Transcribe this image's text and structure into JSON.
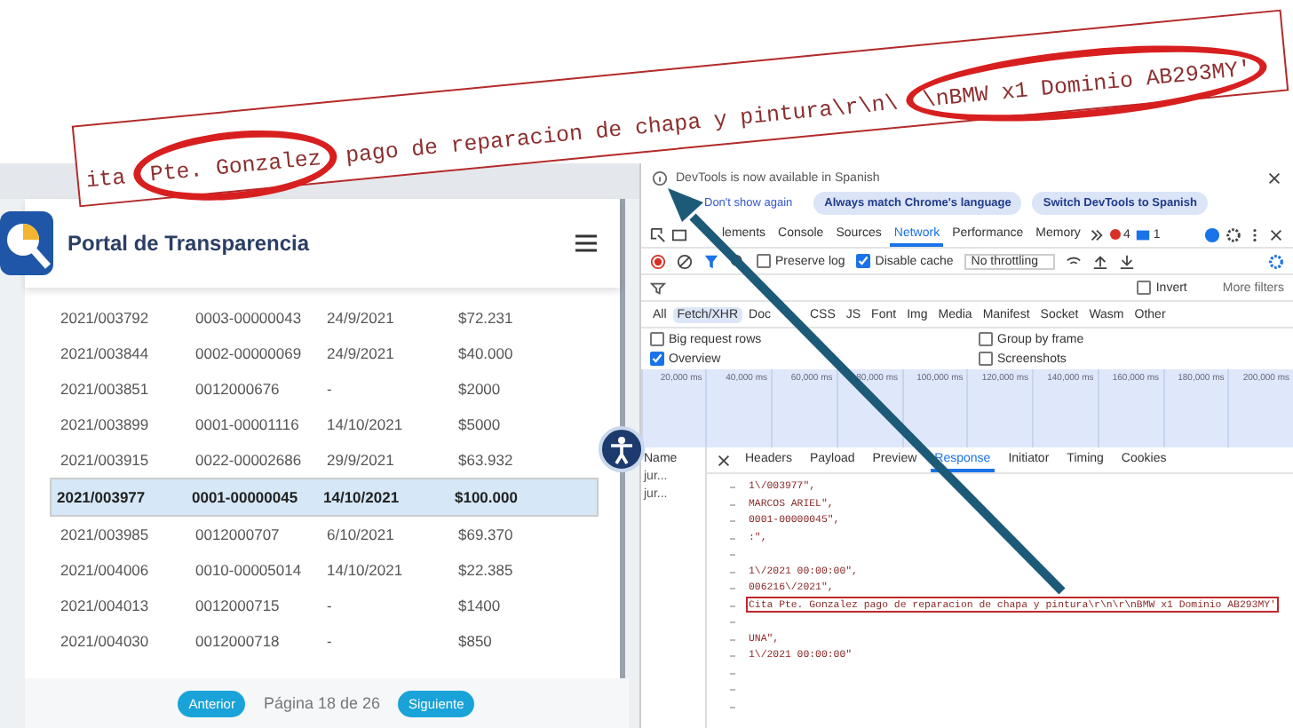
{
  "callout": {
    "segments": [
      {
        "text": "ita",
        "circled": false
      },
      {
        "text": "Pte. Gonzalez",
        "circled": true
      },
      {
        "text": "pago de reparacion de chapa y pintura\\r\\n\\",
        "circled": false
      },
      {
        "text": "\\nBMW x1 Dominio AB293MY'",
        "circled": true
      }
    ]
  },
  "site": {
    "title": "Portal de Transparencia",
    "rows": [
      {
        "cells": [
          "2021/003792",
          "0003-00000043",
          "24/9/2021",
          "$72.231"
        ],
        "selected": false
      },
      {
        "cells": [
          "2021/003844",
          "0002-00000069",
          "24/9/2021",
          "$40.000"
        ],
        "selected": false
      },
      {
        "cells": [
          "2021/003851",
          "0012000676",
          "-",
          "$2000"
        ],
        "selected": false
      },
      {
        "cells": [
          "2021/003899",
          "0001-00001116",
          "14/10/2021",
          "$5000"
        ],
        "selected": false
      },
      {
        "cells": [
          "2021/003915",
          "0022-00002686",
          "29/9/2021",
          "$63.932"
        ],
        "selected": false
      },
      {
        "cells": [
          "2021/003977",
          "0001-00000045",
          "14/10/2021",
          "$100.000"
        ],
        "selected": true
      },
      {
        "cells": [
          "2021/003985",
          "0012000707",
          "6/10/2021",
          "$69.370"
        ],
        "selected": false
      },
      {
        "cells": [
          "2021/004006",
          "0010-00005014",
          "14/10/2021",
          "$22.385"
        ],
        "selected": false
      },
      {
        "cells": [
          "2021/004013",
          "0012000715",
          "-",
          "$1400"
        ],
        "selected": false
      },
      {
        "cells": [
          "2021/004030",
          "0012000718",
          "-",
          "$850"
        ],
        "selected": false
      }
    ],
    "pagination": {
      "previous": "Anterior",
      "label": "Página 18 de 26",
      "next": "Siguiente"
    }
  },
  "devtools": {
    "banner": {
      "message": "DevTools is now available in Spanish",
      "buttons": [
        "Don't show again",
        "Always match Chrome's language",
        "Switch DevTools to Spanish"
      ]
    },
    "tabs": [
      {
        "label": "lements",
        "selected": false
      },
      {
        "label": "Console",
        "selected": false
      },
      {
        "label": "Sources",
        "selected": false
      },
      {
        "label": "Network",
        "selected": true
      },
      {
        "label": "Performance",
        "selected": false
      },
      {
        "label": "Memory",
        "selected": false
      }
    ],
    "errors": "4",
    "messages": "1",
    "preserve_log": {
      "label": "Preserve log",
      "checked": false
    },
    "disable_cache": {
      "label": "Disable cache",
      "checked": true
    },
    "throttling": "No throttling",
    "invert": {
      "label": "Invert",
      "checked": false
    },
    "more_filters": "More filters",
    "types": [
      {
        "label": "All",
        "selected": false
      },
      {
        "label": "Fetch/XHR",
        "selected": true
      },
      {
        "label": "Doc",
        "selected": false
      },
      {
        "label": "CSS",
        "selected": false
      },
      {
        "label": "JS",
        "selected": false
      },
      {
        "label": "Font",
        "selected": false
      },
      {
        "label": "Img",
        "selected": false
      },
      {
        "label": "Media",
        "selected": false
      },
      {
        "label": "Manifest",
        "selected": false
      },
      {
        "label": "Socket",
        "selected": false
      },
      {
        "label": "Wasm",
        "selected": false
      },
      {
        "label": "Other",
        "selected": false
      }
    ],
    "options": [
      {
        "label": "Big request rows",
        "checked": false
      },
      {
        "label": "Group by frame",
        "checked": false
      },
      {
        "label": "Overview",
        "checked": true
      },
      {
        "label": "Screenshots",
        "checked": false
      }
    ],
    "timeline_ticks": [
      "20,000 ms",
      "40,000 ms",
      "60,000 ms",
      "80,000 ms",
      "100,000 ms",
      "120,000 ms",
      "140,000 ms",
      "160,000 ms",
      "180,000 ms",
      "200,000 ms"
    ],
    "requests": {
      "header": "Name",
      "items": [
        "jur...",
        "jur..."
      ]
    },
    "detail_tabs": [
      {
        "label": "Headers",
        "selected": false
      },
      {
        "label": "Payload",
        "selected": false
      },
      {
        "label": "Preview",
        "selected": false
      },
      {
        "label": "Response",
        "selected": true
      },
      {
        "label": "Initiator",
        "selected": false
      },
      {
        "label": "Timing",
        "selected": false
      },
      {
        "label": "Cookies",
        "selected": false
      }
    ],
    "response_lines": [
      {
        "kind": "code",
        "text": "1\\/003977\",",
        "highlighted": false
      },
      {
        "kind": "code",
        "text": "MARCOS ARIEL\",",
        "highlighted": false
      },
      {
        "kind": "code",
        "text": "0001-00000045\",",
        "highlighted": false
      },
      {
        "kind": "code",
        "text": ":\",",
        "highlighted": false
      },
      {
        "kind": "blank"
      },
      {
        "kind": "code",
        "text": "1\\/2021 00:00:00\",",
        "highlighted": false
      },
      {
        "kind": "code",
        "text": "006216\\/2021\",",
        "highlighted": false
      },
      {
        "kind": "code",
        "text": "Cita Pte. Gonzalez pago de reparacion de chapa y pintura\\r\\n\\r\\nBMW x1 Dominio AB293MY'",
        "highlighted": true
      },
      {
        "kind": "blank"
      },
      {
        "kind": "code",
        "text": "UNA\",",
        "highlighted": false
      },
      {
        "kind": "code",
        "text": "1\\/2021 00:00:00\"",
        "highlighted": false
      },
      {
        "kind": "blank"
      },
      {
        "kind": "blank"
      },
      {
        "kind": "blank"
      }
    ]
  }
}
